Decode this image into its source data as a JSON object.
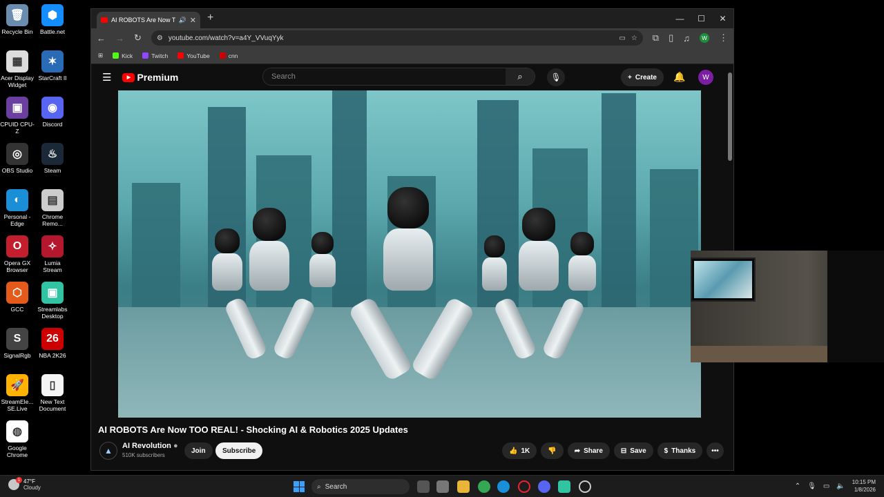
{
  "desktop_icons": [
    {
      "label": "Recycle Bin",
      "icon": "recycle-bin-icon"
    },
    {
      "label": "Battle.net",
      "icon": "battlenet-icon"
    },
    {
      "label": "Acer Display Widget",
      "icon": "acer-display-widget-icon"
    },
    {
      "label": "StarCraft II",
      "icon": "starcraft-icon"
    },
    {
      "label": "CPUID CPU-Z",
      "icon": "cpuz-icon"
    },
    {
      "label": "Discord",
      "icon": "discord-icon"
    },
    {
      "label": "OBS Studio",
      "icon": "obs-icon"
    },
    {
      "label": "Steam",
      "icon": "steam-icon"
    },
    {
      "label": "Personal - Edge",
      "icon": "edge-icon"
    },
    {
      "label": "Chrome Remo...",
      "icon": "chrome-remote-icon"
    },
    {
      "label": "Opera GX Browser",
      "icon": "opera-gx-icon"
    },
    {
      "label": "Lumia Stream",
      "icon": "lumia-stream-icon"
    },
    {
      "label": "GCC",
      "icon": "gcc-icon"
    },
    {
      "label": "Streamlabs Desktop",
      "icon": "streamlabs-icon"
    },
    {
      "label": "SignalRgb",
      "icon": "signalrgb-icon"
    },
    {
      "label": "NBA 2K26",
      "icon": "nba2k26-icon"
    },
    {
      "label": "StreamEle... SE.Live",
      "icon": "streamelements-icon"
    },
    {
      "label": "New Text Document",
      "icon": "text-document-icon"
    },
    {
      "label": "Google Chrome",
      "icon": "chrome-icon"
    }
  ],
  "browser": {
    "tab_title": "AI ROBOTS Are Now TOO R",
    "url": "youtube.com/watch?v=a4Y_VVuqYyk",
    "profile_initial": "W",
    "bookmarks": [
      {
        "label": "Kick",
        "color": "#53fc18"
      },
      {
        "label": "Twitch",
        "color": "#9146ff"
      },
      {
        "label": "YouTube",
        "color": "#ff0000"
      },
      {
        "label": "cnn",
        "color": "#cc0000"
      }
    ]
  },
  "youtube": {
    "logo_text": "Premium",
    "search_placeholder": "Search",
    "create_label": "Create",
    "avatar_initial": "W",
    "video_title": "AI ROBOTS Are Now TOO REAL! - Shocking AI & Robotics 2025 Updates",
    "channel_name": "AI Revolution",
    "subscribers": "510K subscribers",
    "join_label": "Join",
    "subscribe_label": "Subscribe",
    "likes": "1K",
    "share_label": "Share",
    "save_label": "Save",
    "thanks_label": "Thanks"
  },
  "taskbar": {
    "temperature": "47°F",
    "weather": "Cloudy",
    "search_label": "Search",
    "time": "10:15 PM",
    "date": "1/8/2026"
  },
  "colors": {
    "yt_red": "#ff0000",
    "accent_blue": "#3aa0ff",
    "avatar_purple": "#7b1fa2"
  }
}
